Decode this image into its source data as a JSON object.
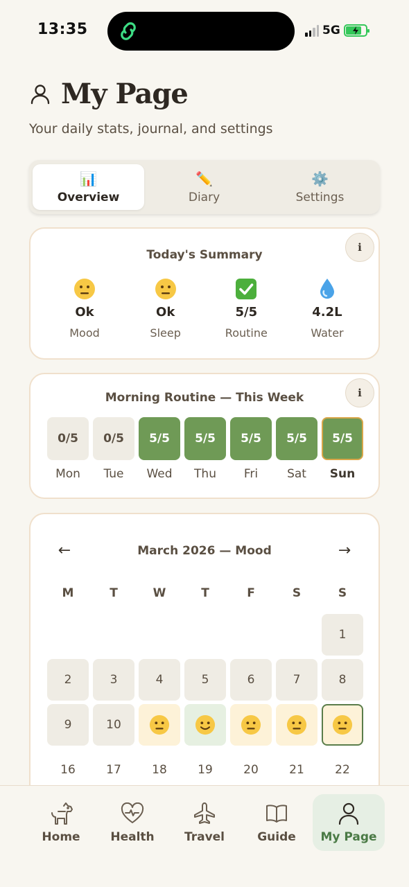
{
  "status_bar": {
    "time": "13:35",
    "network": "5G"
  },
  "header": {
    "title": "My Page",
    "subtitle": "Your daily stats, journal, and settings"
  },
  "tabs": [
    {
      "label": "Overview",
      "icon": "📊",
      "active": true
    },
    {
      "label": "Diary",
      "icon": "✏️",
      "active": false
    },
    {
      "label": "Settings",
      "icon": "⚙️",
      "active": false
    }
  ],
  "summary": {
    "title": "Today's Summary",
    "info": "i",
    "stats": [
      {
        "icon": "neutral-face",
        "value": "Ok",
        "label": "Mood"
      },
      {
        "icon": "neutral-face",
        "value": "Ok",
        "label": "Sleep"
      },
      {
        "icon": "check-mark",
        "value": "5/5",
        "label": "Routine"
      },
      {
        "icon": "droplet",
        "value": "4.2L",
        "label": "Water"
      }
    ]
  },
  "routine": {
    "title": "Morning Routine — This Week",
    "info": "i",
    "days": [
      {
        "value": "0/5",
        "label": "Mon",
        "done": false,
        "today": false
      },
      {
        "value": "0/5",
        "label": "Tue",
        "done": false,
        "today": false
      },
      {
        "value": "5/5",
        "label": "Wed",
        "done": true,
        "today": false
      },
      {
        "value": "5/5",
        "label": "Thu",
        "done": true,
        "today": false
      },
      {
        "value": "5/5",
        "label": "Fri",
        "done": true,
        "today": false
      },
      {
        "value": "5/5",
        "label": "Sat",
        "done": true,
        "today": false
      },
      {
        "value": "5/5",
        "label": "Sun",
        "done": true,
        "today": true
      }
    ]
  },
  "calendar": {
    "title": "March 2026 — Mood",
    "prev": "←",
    "next": "→",
    "weekdays": [
      "M",
      "T",
      "W",
      "T",
      "F",
      "S",
      "S"
    ],
    "cells": [
      {
        "type": "empty"
      },
      {
        "type": "empty"
      },
      {
        "type": "empty"
      },
      {
        "type": "empty"
      },
      {
        "type": "empty"
      },
      {
        "type": "empty"
      },
      {
        "type": "plain",
        "text": "1"
      },
      {
        "type": "plain",
        "text": "2"
      },
      {
        "type": "plain",
        "text": "3"
      },
      {
        "type": "plain",
        "text": "4"
      },
      {
        "type": "plain",
        "text": "5"
      },
      {
        "type": "plain",
        "text": "6"
      },
      {
        "type": "plain",
        "text": "7"
      },
      {
        "type": "plain",
        "text": "8"
      },
      {
        "type": "plain",
        "text": "9"
      },
      {
        "type": "plain",
        "text": "10"
      },
      {
        "type": "mood-neutral",
        "mood": "neutral-face"
      },
      {
        "type": "mood-good",
        "mood": "smile-face"
      },
      {
        "type": "mood-neutral",
        "mood": "neutral-face"
      },
      {
        "type": "mood-neutral",
        "mood": "neutral-face"
      },
      {
        "type": "today",
        "mood": "neutral-face"
      },
      {
        "type": "bare",
        "text": "16"
      },
      {
        "type": "bare",
        "text": "17"
      },
      {
        "type": "bare",
        "text": "18"
      },
      {
        "type": "bare",
        "text": "19"
      },
      {
        "type": "bare",
        "text": "20"
      },
      {
        "type": "bare",
        "text": "21"
      },
      {
        "type": "bare",
        "text": "22"
      }
    ]
  },
  "nav": [
    {
      "label": "Home",
      "icon": "dog-icon",
      "active": false
    },
    {
      "label": "Health",
      "icon": "heart-pulse-icon",
      "active": false
    },
    {
      "label": "Travel",
      "icon": "plane-icon",
      "active": false
    },
    {
      "label": "Guide",
      "icon": "book-icon",
      "active": false
    },
    {
      "label": "My Page",
      "icon": "person-icon",
      "active": true
    }
  ],
  "colors": {
    "background": "#f8f6f0",
    "routine_done": "#6f9a56",
    "active_nav": "#e6efe4",
    "card_border": "#f0e0cc"
  }
}
